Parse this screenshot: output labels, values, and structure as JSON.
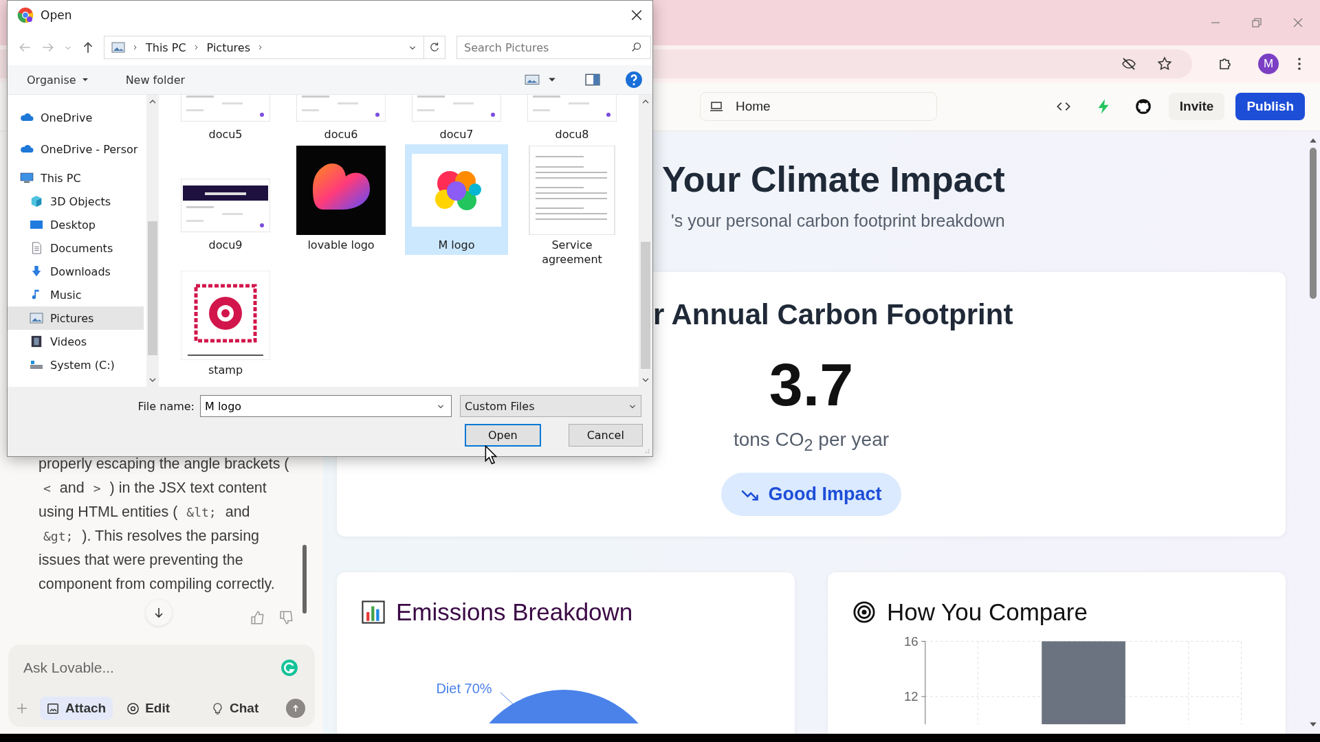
{
  "toolbar": {
    "avatar": "M"
  },
  "app_header": {
    "route": "Home",
    "invite": "Invite",
    "publish": "Publish"
  },
  "chat": {
    "message": [
      {
        "kind": "text",
        "text": "properly escaping the angle brackets ("
      },
      {
        "kind": "code",
        "text": "<"
      },
      {
        "kind": "text",
        "text": "and"
      },
      {
        "kind": "code",
        "text": ">"
      },
      {
        "kind": "text",
        "text": ") in the JSX text content using HTML entities ("
      },
      {
        "kind": "code",
        "text": "&lt;"
      },
      {
        "kind": "text",
        "text": "and"
      },
      {
        "kind": "code",
        "text": "&gt;"
      },
      {
        "kind": "text",
        "text": "). This resolves the parsing issues that were preventing the component from compiling correctly."
      }
    ],
    "input": {
      "placeholder": "Ask Lovable..."
    },
    "actions": [
      {
        "label": "Attach",
        "kind": "attach",
        "selected": true
      },
      {
        "label": "Edit",
        "kind": "edit",
        "selected": false
      },
      {
        "label": "Chat",
        "kind": "chat",
        "selected": false
      }
    ]
  },
  "preview": {
    "title": "Your Climate Impact",
    "subtitle": "'s your personal carbon footprint breakdown",
    "footprint_card": {
      "heading": "r Annual Carbon Footprint",
      "value": "3.7",
      "unit": "tons CO$_{2}$ per year",
      "badge": "Good Impact"
    },
    "emissions_card": {
      "title": "Emissions Breakdown",
      "chart_data": {
        "type": "pie",
        "categories": [
          "Diet"
        ],
        "values": [
          70
        ],
        "value_labels": [
          "70%"
        ]
      }
    },
    "compare_card": {
      "title": "How You Compare",
      "chart_data": {
        "type": "bar",
        "values": [
          null,
          16,
          null
        ],
        "ylim": [
          10,
          16
        ],
        "grid": true,
        "yticks": [
          12,
          16
        ]
      }
    }
  },
  "dialog": {
    "title": "Open",
    "breadcrumb": [
      "This PC",
      "Pictures"
    ],
    "search": {
      "placeholder": "Search Pictures"
    },
    "organise": "Organise",
    "new_folder": "New folder",
    "nav": [
      {
        "label": "OneDrive",
        "kind": "cloud",
        "selected": false
      },
      {
        "label": "OneDrive - Persor",
        "kind": "cloud",
        "selected": false
      },
      {
        "label": "This PC",
        "kind": "pc",
        "selected": false,
        "children": [
          {
            "label": "3D Objects",
            "kind": "cube",
            "selected": false
          },
          {
            "label": "Desktop",
            "kind": "desktop",
            "selected": false
          },
          {
            "label": "Documents",
            "kind": "documents",
            "selected": false
          },
          {
            "label": "Downloads",
            "kind": "downloads",
            "selected": false
          },
          {
            "label": "Music",
            "kind": "music",
            "selected": false
          },
          {
            "label": "Pictures",
            "kind": "pictures",
            "selected": true
          },
          {
            "label": "Videos",
            "kind": "videos",
            "selected": false
          },
          {
            "label": "System (C:)",
            "kind": "drive",
            "selected": false
          }
        ]
      }
    ],
    "files": [
      {
        "name": "docu5",
        "kind": "doc",
        "selected": false
      },
      {
        "name": "docu6",
        "kind": "doc",
        "selected": false
      },
      {
        "name": "docu7",
        "kind": "doc",
        "selected": false
      },
      {
        "name": "docu8",
        "kind": "doc",
        "selected": false
      },
      {
        "name": "docu9",
        "kind": "dark_doc",
        "selected": false
      },
      {
        "name": "lovable logo",
        "kind": "heart",
        "selected": false
      },
      {
        "name": "M logo",
        "kind": "splash",
        "selected": true
      },
      {
        "name": "Service agreement",
        "kind": "text",
        "selected": false
      },
      {
        "name": "stamp",
        "kind": "stamp",
        "selected": false
      }
    ],
    "file_name": {
      "label": "File name:",
      "value": "M logo"
    },
    "file_type": "Custom Files",
    "open": "Open",
    "cancel": "Cancel"
  }
}
